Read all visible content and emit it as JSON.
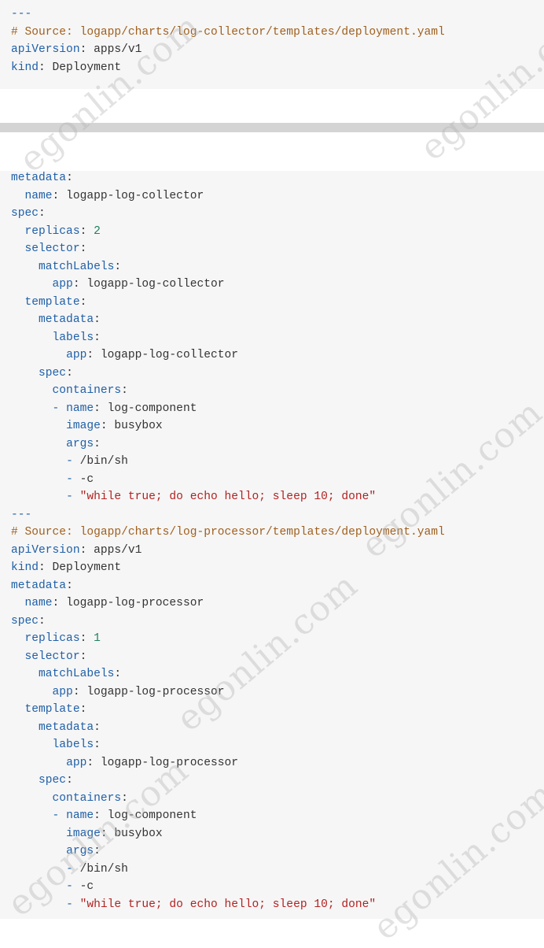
{
  "block1": {
    "sep": "---",
    "comment": "# Source: logapp/charts/log-collector/templates/deployment.yaml",
    "api_key": "apiVersion",
    "api_val": "apps/v1",
    "kind_key": "kind",
    "kind_val": "Deployment"
  },
  "block2": {
    "meta_key": "metadata",
    "name_key": "name",
    "name_val": "logapp-log-collector",
    "spec_key": "spec",
    "replicas_key": "replicas",
    "replicas_val": "2",
    "selector_key": "selector",
    "match_key": "matchLabels",
    "app_key": "app",
    "app_val": "logapp-log-collector",
    "template_key": "template",
    "t_meta_key": "metadata",
    "labels_key": "labels",
    "labels_app_key": "app",
    "labels_app_val": "logapp-log-collector",
    "t_spec_key": "spec",
    "containers_key": "containers",
    "c_name_key": "name",
    "c_name_val": "log-component",
    "image_key": "image",
    "image_val": "busybox",
    "args_key": "args",
    "arg1": "/bin/sh",
    "arg2": "-c",
    "arg3": "\"while true; do echo hello; sleep 10; done\"",
    "sep2": "---",
    "comment2": "# Source: logapp/charts/log-processor/templates/deployment.yaml",
    "api_key2": "apiVersion",
    "api_val2": "apps/v1",
    "kind_key2": "kind",
    "kind_val2": "Deployment",
    "meta_key2": "metadata",
    "name_key2": "name",
    "name_val2": "logapp-log-processor",
    "spec_key2": "spec",
    "replicas_key2": "replicas",
    "replicas_val2": "1",
    "selector_key2": "selector",
    "match_key2": "matchLabels",
    "app_key2": "app",
    "app_val2": "logapp-log-processor",
    "template_key2": "template",
    "t_meta_key2": "metadata",
    "labels_key2": "labels",
    "labels_app_key2": "app",
    "labels_app_val2": "logapp-log-processor",
    "t_spec_key2": "spec",
    "containers_key2": "containers",
    "c_name_key2": "name",
    "c_name_val2": "log-component",
    "image_key2": "image",
    "image_val2": "busybox",
    "args_key2": "args",
    "arg1b": "/bin/sh",
    "arg2b": "-c",
    "arg3b": "\"while true; do echo hello; sleep 10; done\""
  },
  "watermark": "egonlin.com",
  "colors": {
    "key": "#2060a8",
    "comment": "#a0601f",
    "number": "#208060",
    "string": "#b22222",
    "background": "#f6f6f6"
  }
}
